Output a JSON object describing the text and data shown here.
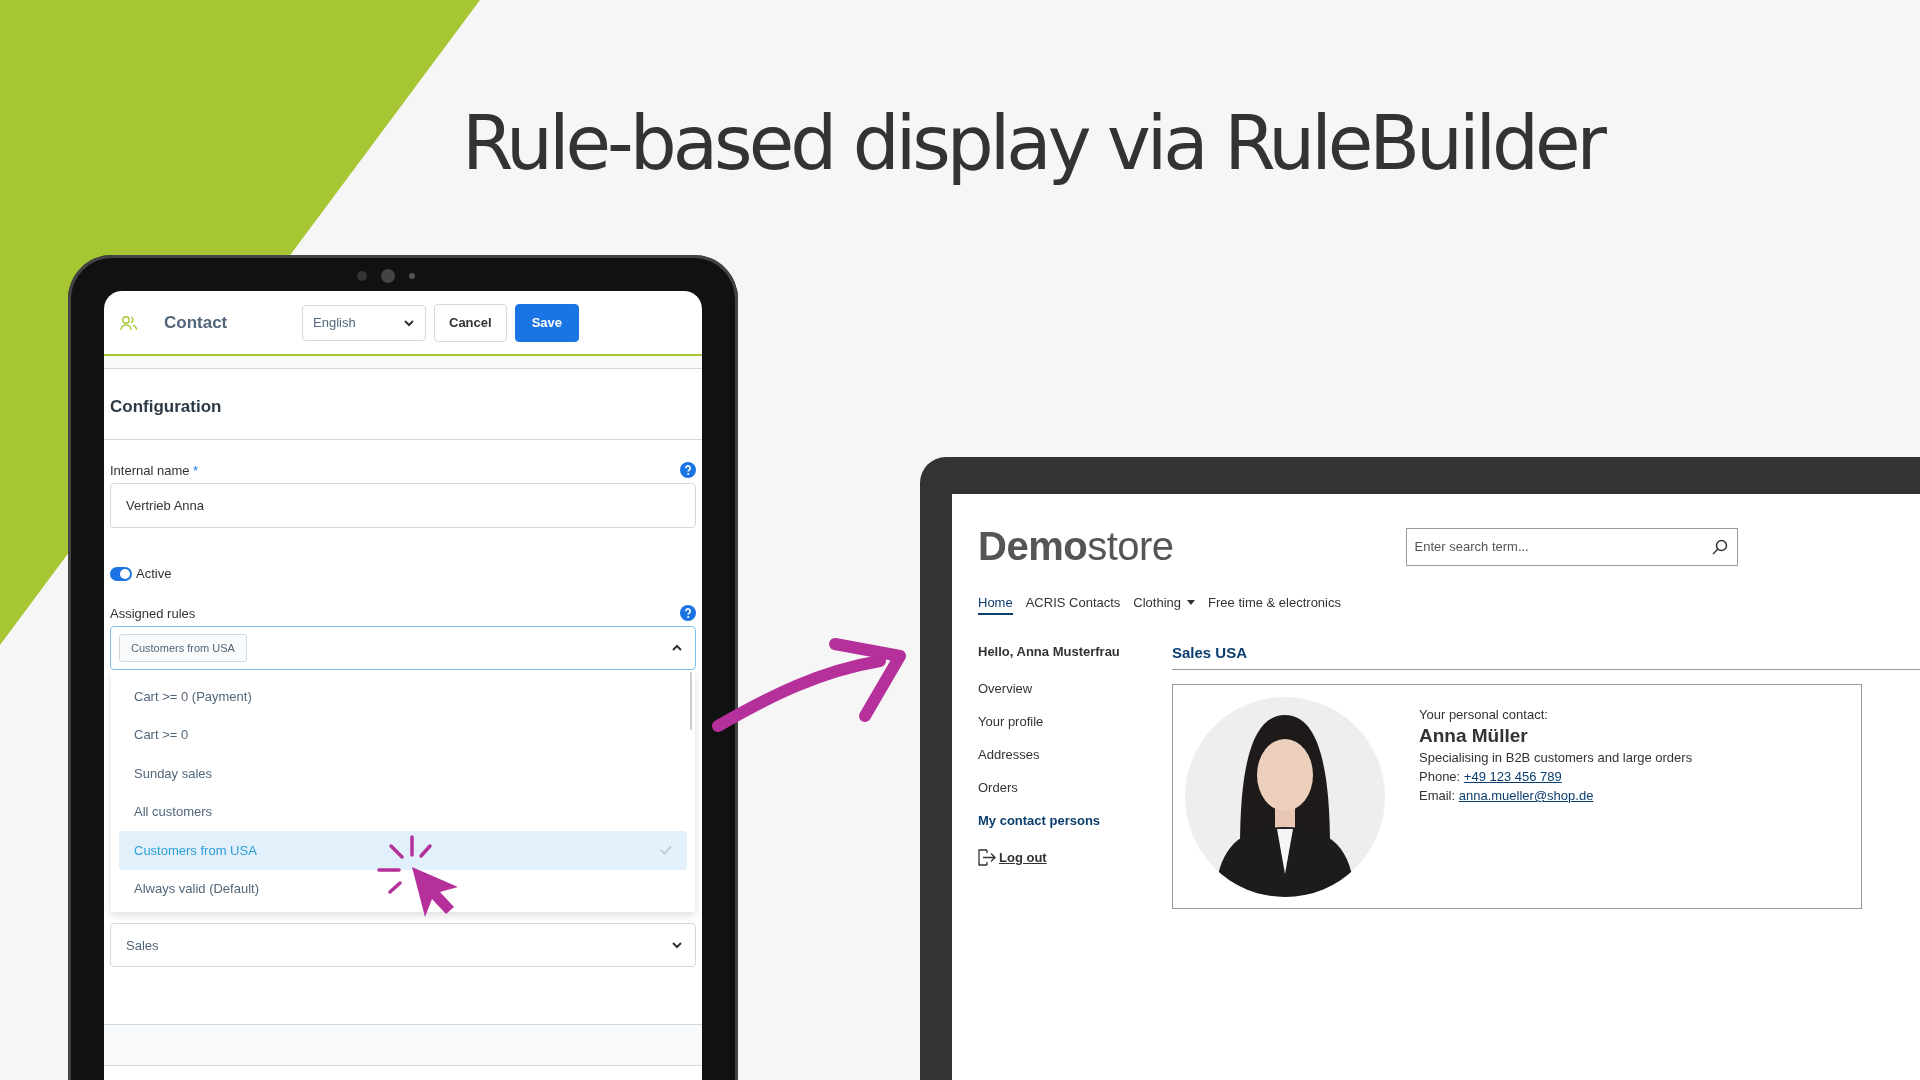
{
  "headline": "Rule-based display via RuleBuilder",
  "admin": {
    "title": "Contact",
    "language": "English",
    "buttons": [
      {
        "label": "Cancel",
        "kind": "secondary"
      },
      {
        "label": "Save",
        "kind": "primary"
      }
    ],
    "section": "Configuration",
    "internal_name": {
      "label": "Internal name",
      "required_mark": "*",
      "value": "Vertrieb Anna"
    },
    "active": {
      "label": "Active",
      "on": true
    },
    "assigned_rules": {
      "label": "Assigned rules",
      "tags": [
        "Customers from USA"
      ],
      "expanded": true,
      "options": [
        {
          "label": "Cart >= 0 (Payment)",
          "selected": false
        },
        {
          "label": "Cart >= 0",
          "selected": false
        },
        {
          "label": "Sunday sales",
          "selected": false
        },
        {
          "label": "All customers",
          "selected": false
        },
        {
          "label": "Customers from USA",
          "selected": true
        },
        {
          "label": "Always valid (Default)",
          "selected": false
        }
      ]
    },
    "contact_group": {
      "value": "Sales"
    }
  },
  "store": {
    "logo_bold": "Demo",
    "logo_light": "store",
    "search": {
      "placeholder": "Enter search term..."
    },
    "nav": [
      {
        "label": "Home",
        "selected": true,
        "dropdown": false
      },
      {
        "label": "ACRIS Contacts",
        "selected": false,
        "dropdown": false
      },
      {
        "label": "Clothing",
        "selected": false,
        "dropdown": true
      },
      {
        "label": "Free time & electronics",
        "selected": false,
        "dropdown": false
      }
    ],
    "greeting": "Hello, Anna Musterfrau",
    "account_menu": [
      {
        "label": "Overview",
        "selected": false
      },
      {
        "label": "Your profile",
        "selected": false
      },
      {
        "label": "Addresses",
        "selected": false
      },
      {
        "label": "Orders",
        "selected": false
      },
      {
        "label": "My contact persons",
        "selected": true
      }
    ],
    "logout": "Log out",
    "heading": "Sales USA",
    "contact": {
      "intro": "Your personal contact:",
      "name": "Anna Müller",
      "specialty": "Specialising in B2B customers and large orders",
      "phone_label": "Phone:",
      "phone": "+49 123 456 789",
      "email_label": "Email:",
      "email": "anna.mueller@shop.de"
    }
  }
}
